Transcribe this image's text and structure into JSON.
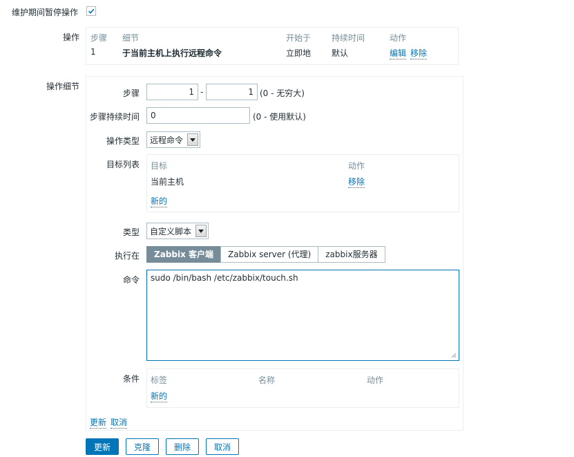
{
  "pause_label": "维护期间暂停操作",
  "pause_checked": true,
  "operations": {
    "label": "操作",
    "headers": [
      "步骤",
      "细节",
      "开始于",
      "持续时间",
      "动作"
    ],
    "row": {
      "step": "1",
      "details": "于当前主机上执行远程命令",
      "start": "立即地",
      "duration": "默认",
      "edit_label": "编辑",
      "remove_label": "移除"
    }
  },
  "details": {
    "label": "操作细节",
    "steps_label": "步骤",
    "step_from": "1",
    "step_sep": "-",
    "step_to": "1",
    "step_hint": "(0 - 无穷大)",
    "duration_label": "步骤持续时间",
    "duration_value": "0",
    "duration_hint": "(0 - 使用默认)",
    "op_type_label": "操作类型",
    "op_type_value": "远程命令",
    "target_list_label": "目标列表",
    "target_headers": [
      "目标",
      "动作"
    ],
    "target_row": {
      "target": "当前主机",
      "remove_label": "移除"
    },
    "target_new": "新的",
    "type_label": "类型",
    "type_value": "自定义脚本",
    "execute_on_label": "执行在",
    "execute_on_options": [
      "Zabbix 客户端",
      "Zabbix server (代理)",
      "zabbix服务器"
    ],
    "command_label": "命令",
    "command_value": "sudo /bin/bash /etc/zabbix/touch.sh",
    "conditions_label": "条件",
    "condition_headers": [
      "标签",
      "名称",
      "动作"
    ],
    "condition_new": "新的",
    "update_link": "更新",
    "cancel_link": "取消"
  },
  "buttons": {
    "update": "更新",
    "clone": "克隆",
    "delete": "删除",
    "cancel": "取消"
  },
  "colors": {
    "accent": "#0275b8",
    "active_tab": "#768d99",
    "muted": "#768d99"
  }
}
